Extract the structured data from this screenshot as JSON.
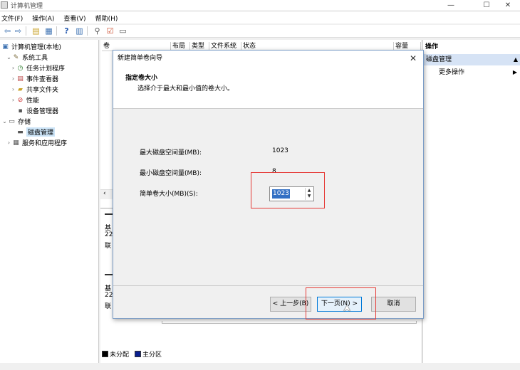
{
  "window": {
    "title": "计算机管理"
  },
  "menu": [
    "文件(F)",
    "操作(A)",
    "查看(V)",
    "帮助(H)"
  ],
  "tree": {
    "root": "计算机管理(本地)",
    "system_tools": "系统工具",
    "task_scheduler": "任务计划程序",
    "event_viewer": "事件查看器",
    "shared_folders": "共享文件夹",
    "performance": "性能",
    "device_manager": "设备管理器",
    "storage": "存储",
    "disk_management": "磁盘管理",
    "services": "服务和应用程序"
  },
  "columns": {
    "volume": "卷",
    "layout": "布局",
    "type": "类型",
    "filesystem": "文件系统",
    "status": "状态",
    "capacity": "容量"
  },
  "disk_rows": {
    "d1a": "基",
    "d1b": "22",
    "d1c": "联",
    "d2a": "基",
    "d2b": "22",
    "d2c": "联"
  },
  "actions": {
    "header": "操作",
    "selected": "磁盘管理",
    "more": "更多操作"
  },
  "legend": {
    "unallocated": "未分配",
    "primary": "主分区"
  },
  "dialog": {
    "title": "新建简单卷向导",
    "heading": "指定卷大小",
    "subheading": "选择介于最大和最小值的卷大小。",
    "max_label": "最大磁盘空间量(MB):",
    "max_value": "1023",
    "min_label": "最小磁盘空间量(MB):",
    "min_value": "8",
    "size_label": "简单卷大小(MB)(S):",
    "size_value": "1023",
    "back": "< 上一步(B)",
    "next": "下一页(N) >",
    "cancel": "取消"
  },
  "colors": {
    "accent": "#0078d7",
    "highlight": "#e53935",
    "selection": "#3370c4",
    "primary_partition": "#0a1f8f",
    "unallocated": "#000000"
  }
}
